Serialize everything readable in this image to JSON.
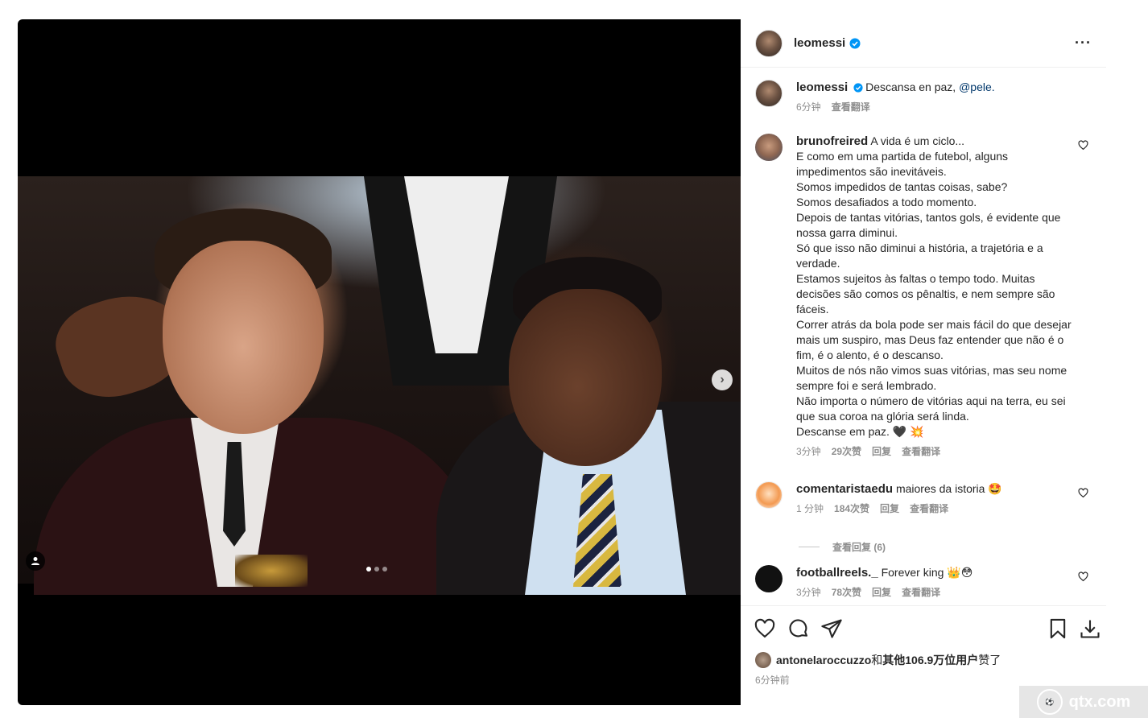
{
  "post": {
    "username": "leomessi",
    "more_label": "···"
  },
  "caption": {
    "username": "leomessi",
    "text": "Descansa en paz, ",
    "mention": "@pele.",
    "time": "6分钟",
    "translate": "查看翻译"
  },
  "comments": [
    {
      "username": "brunofreired",
      "lines": [
        "A vida é um ciclo...",
        "E como em uma partida de futebol, alguns impedimentos são inevitáveis.",
        "Somos impedidos de tantas coisas, sabe?",
        "Somos desafiados a todo momento.",
        "Depois de tantas vitórias, tantos gols, é evidente que nossa garra diminui.",
        "Só que isso não diminui a história, a trajetória e a verdade.",
        "Estamos sujeitos às faltas o tempo todo. Muitas decisões são comos os pênaltis, e nem sempre são fáceis.",
        "Correr atrás da bola pode ser mais fácil do que desejar mais um suspiro, mas Deus faz entender que não é o fim, é o alento, é o descanso.",
        "Muitos de nós não vimos suas vitórias, mas seu nome sempre foi e será lembrado.",
        "Não importa o número de vitórias aqui na terra, eu sei que sua coroa na glória será linda.",
        "Descanse em paz. 🖤 💥"
      ],
      "time": "3分钟",
      "likes": "29次赞",
      "reply": "回复",
      "translate": "查看翻译"
    },
    {
      "username": "comentaristaedu",
      "text": "maiores da istoria 🤩",
      "time": "1 分钟",
      "likes": "184次赞",
      "reply": "回复",
      "translate": "查看翻译",
      "view_replies": "查看回复 (6)"
    },
    {
      "username": "footballreels._",
      "text": "Forever king 👑😳",
      "time": "3分钟",
      "likes": "78次赞",
      "reply": "回复",
      "translate": "查看翻译"
    }
  ],
  "likes_line": {
    "user": "antonelaroccuzzo",
    "mid": "和",
    "others": "其他106.9万位用户",
    "end": "赞了"
  },
  "posted_ago": "6分钟前",
  "watermark": "qtx.com",
  "colors": {
    "verified": "#0095f6",
    "mention": "#00376b",
    "muted": "#8e8e8e"
  }
}
